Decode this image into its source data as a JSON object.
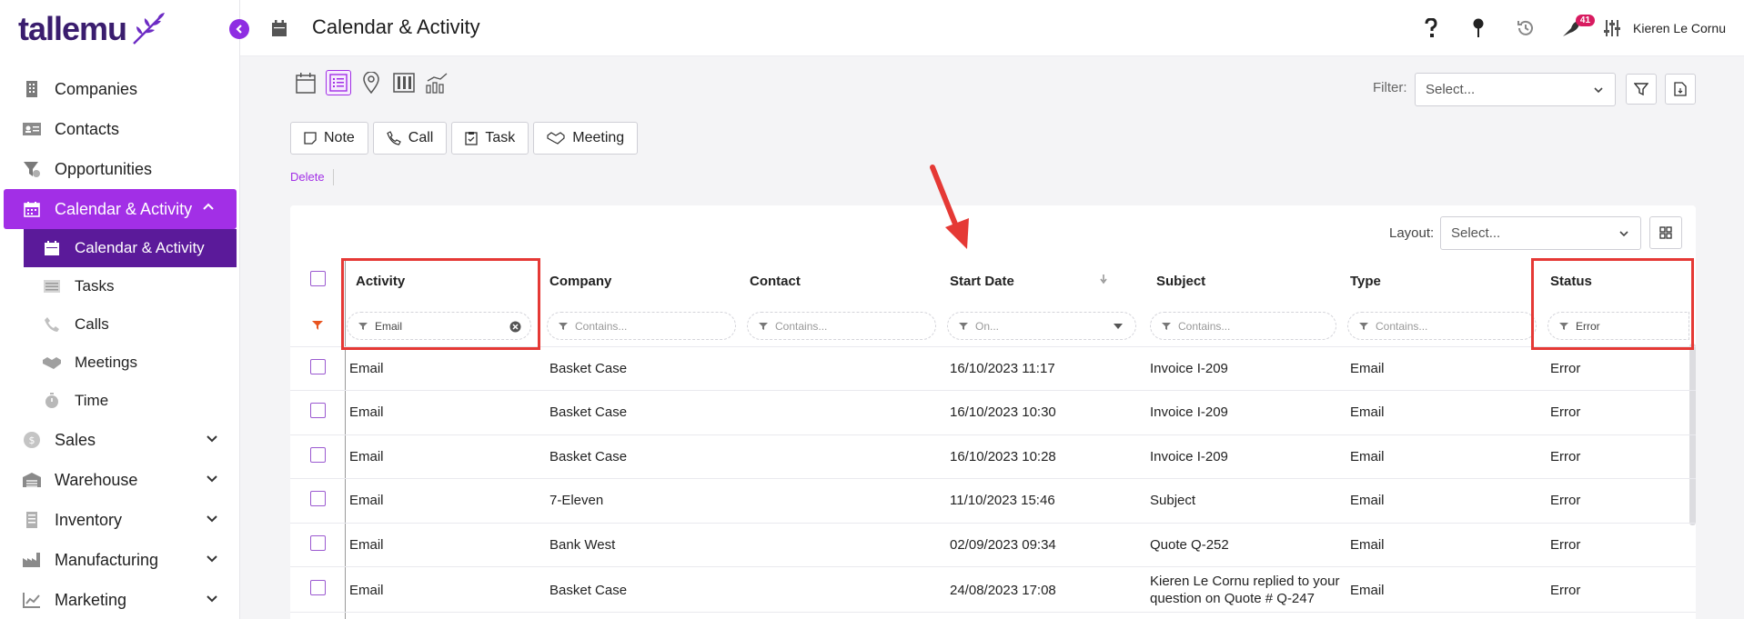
{
  "app": {
    "logo_text": "tallemu",
    "page_title": "Calendar & Activity",
    "user_name": "Kieren Le Cornu",
    "notification_count": "41",
    "accent_color": "#a22fe6"
  },
  "sidebar": {
    "items": [
      {
        "label": "Companies",
        "icon": "building-icon"
      },
      {
        "label": "Contacts",
        "icon": "contact-card-icon"
      },
      {
        "label": "Opportunities",
        "icon": "funnel-icon"
      },
      {
        "label": "Calendar & Activity",
        "icon": "calendar-icon",
        "active": true,
        "expanded": true
      },
      {
        "label": "Sales",
        "icon": "dollar-coin-icon"
      },
      {
        "label": "Warehouse",
        "icon": "warehouse-icon"
      },
      {
        "label": "Inventory",
        "icon": "inventory-icon"
      },
      {
        "label": "Manufacturing",
        "icon": "factory-icon"
      },
      {
        "label": "Marketing",
        "icon": "chart-icon"
      }
    ],
    "subitems": [
      {
        "label": "Calendar & Activity",
        "icon": "calendar-icon",
        "active": true
      },
      {
        "label": "Tasks",
        "icon": "list-icon"
      },
      {
        "label": "Calls",
        "icon": "phone-icon"
      },
      {
        "label": "Meetings",
        "icon": "handshake-icon"
      },
      {
        "label": "Time",
        "icon": "stopwatch-icon"
      }
    ]
  },
  "toolbar": {
    "filter_label": "Filter:",
    "filter_placeholder": "Select...",
    "layout_label": "Layout:",
    "layout_placeholder": "Select...",
    "actions": [
      {
        "label": "Note",
        "icon": "note-icon"
      },
      {
        "label": "Call",
        "icon": "phone-icon"
      },
      {
        "label": "Task",
        "icon": "clipboard-icon"
      },
      {
        "label": "Meeting",
        "icon": "handshake-icon"
      }
    ],
    "delete_label": "Delete"
  },
  "grid": {
    "columns": [
      {
        "label": "Activity",
        "filter": "Email",
        "filled": true
      },
      {
        "label": "Company",
        "filter": "Contains...",
        "filled": false
      },
      {
        "label": "Contact",
        "filter": "Contains...",
        "filled": false
      },
      {
        "label": "Start Date",
        "filter": "On...",
        "filled": false
      },
      {
        "label": "Subject",
        "filter": "Contains...",
        "filled": false
      },
      {
        "label": "Type",
        "filter": "Contains...",
        "filled": false
      },
      {
        "label": "Status",
        "filter": "Error",
        "filled": true
      }
    ],
    "rows": [
      {
        "activity": "Email",
        "company": "Basket Case",
        "contact": "",
        "start_date": "16/10/2023 11:17",
        "subject": "Invoice I-209",
        "type": "Email",
        "status": "Error"
      },
      {
        "activity": "Email",
        "company": "Basket Case",
        "contact": "",
        "start_date": "16/10/2023 10:30",
        "subject": "Invoice I-209",
        "type": "Email",
        "status": "Error"
      },
      {
        "activity": "Email",
        "company": "Basket Case",
        "contact": "",
        "start_date": "16/10/2023 10:28",
        "subject": "Invoice I-209",
        "type": "Email",
        "status": "Error"
      },
      {
        "activity": "Email",
        "company": "7-Eleven",
        "contact": "",
        "start_date": "11/10/2023 15:46",
        "subject": "Subject",
        "type": "Email",
        "status": "Error"
      },
      {
        "activity": "Email",
        "company": "Bank West",
        "contact": "",
        "start_date": "02/09/2023 09:34",
        "subject": "Quote Q-252",
        "type": "Email",
        "status": "Error"
      },
      {
        "activity": "Email",
        "company": "Basket Case",
        "contact": "",
        "start_date": "24/08/2023 17:08",
        "subject": "Kieren Le Cornu replied to your question on Quote # Q-247",
        "type": "Email",
        "status": "Error"
      }
    ]
  }
}
